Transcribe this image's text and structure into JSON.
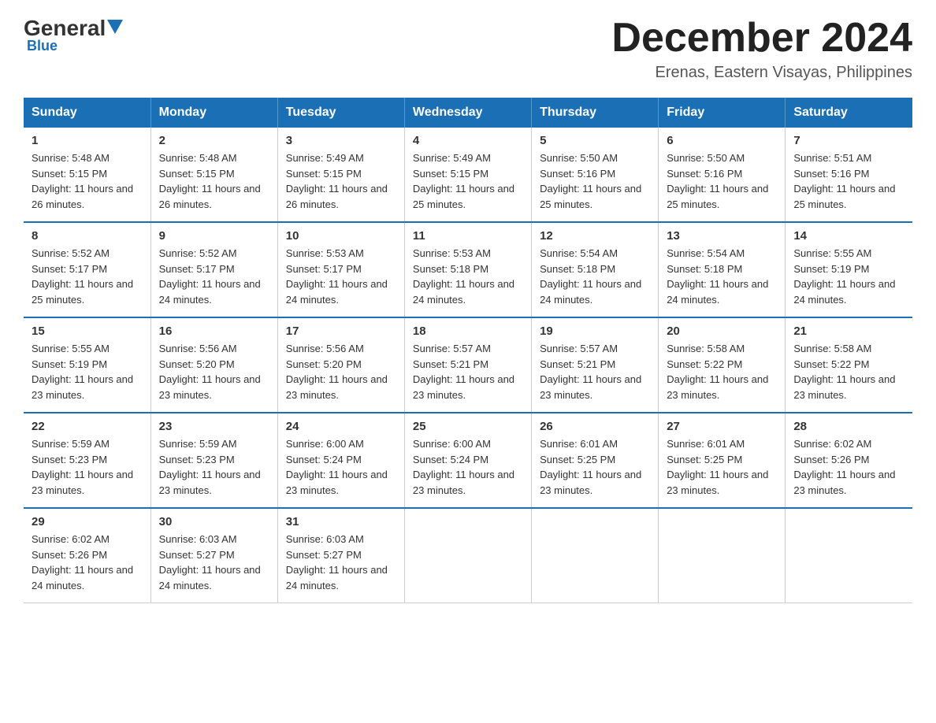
{
  "header": {
    "logo_general": "General",
    "logo_blue": "Blue",
    "month_title": "December 2024",
    "location": "Erenas, Eastern Visayas, Philippines"
  },
  "weekdays": [
    "Sunday",
    "Monday",
    "Tuesday",
    "Wednesday",
    "Thursday",
    "Friday",
    "Saturday"
  ],
  "weeks": [
    [
      {
        "day": "1",
        "sunrise": "5:48 AM",
        "sunset": "5:15 PM",
        "daylight": "11 hours and 26 minutes."
      },
      {
        "day": "2",
        "sunrise": "5:48 AM",
        "sunset": "5:15 PM",
        "daylight": "11 hours and 26 minutes."
      },
      {
        "day": "3",
        "sunrise": "5:49 AM",
        "sunset": "5:15 PM",
        "daylight": "11 hours and 26 minutes."
      },
      {
        "day": "4",
        "sunrise": "5:49 AM",
        "sunset": "5:15 PM",
        "daylight": "11 hours and 25 minutes."
      },
      {
        "day": "5",
        "sunrise": "5:50 AM",
        "sunset": "5:16 PM",
        "daylight": "11 hours and 25 minutes."
      },
      {
        "day": "6",
        "sunrise": "5:50 AM",
        "sunset": "5:16 PM",
        "daylight": "11 hours and 25 minutes."
      },
      {
        "day": "7",
        "sunrise": "5:51 AM",
        "sunset": "5:16 PM",
        "daylight": "11 hours and 25 minutes."
      }
    ],
    [
      {
        "day": "8",
        "sunrise": "5:52 AM",
        "sunset": "5:17 PM",
        "daylight": "11 hours and 25 minutes."
      },
      {
        "day": "9",
        "sunrise": "5:52 AM",
        "sunset": "5:17 PM",
        "daylight": "11 hours and 24 minutes."
      },
      {
        "day": "10",
        "sunrise": "5:53 AM",
        "sunset": "5:17 PM",
        "daylight": "11 hours and 24 minutes."
      },
      {
        "day": "11",
        "sunrise": "5:53 AM",
        "sunset": "5:18 PM",
        "daylight": "11 hours and 24 minutes."
      },
      {
        "day": "12",
        "sunrise": "5:54 AM",
        "sunset": "5:18 PM",
        "daylight": "11 hours and 24 minutes."
      },
      {
        "day": "13",
        "sunrise": "5:54 AM",
        "sunset": "5:18 PM",
        "daylight": "11 hours and 24 minutes."
      },
      {
        "day": "14",
        "sunrise": "5:55 AM",
        "sunset": "5:19 PM",
        "daylight": "11 hours and 24 minutes."
      }
    ],
    [
      {
        "day": "15",
        "sunrise": "5:55 AM",
        "sunset": "5:19 PM",
        "daylight": "11 hours and 23 minutes."
      },
      {
        "day": "16",
        "sunrise": "5:56 AM",
        "sunset": "5:20 PM",
        "daylight": "11 hours and 23 minutes."
      },
      {
        "day": "17",
        "sunrise": "5:56 AM",
        "sunset": "5:20 PM",
        "daylight": "11 hours and 23 minutes."
      },
      {
        "day": "18",
        "sunrise": "5:57 AM",
        "sunset": "5:21 PM",
        "daylight": "11 hours and 23 minutes."
      },
      {
        "day": "19",
        "sunrise": "5:57 AM",
        "sunset": "5:21 PM",
        "daylight": "11 hours and 23 minutes."
      },
      {
        "day": "20",
        "sunrise": "5:58 AM",
        "sunset": "5:22 PM",
        "daylight": "11 hours and 23 minutes."
      },
      {
        "day": "21",
        "sunrise": "5:58 AM",
        "sunset": "5:22 PM",
        "daylight": "11 hours and 23 minutes."
      }
    ],
    [
      {
        "day": "22",
        "sunrise": "5:59 AM",
        "sunset": "5:23 PM",
        "daylight": "11 hours and 23 minutes."
      },
      {
        "day": "23",
        "sunrise": "5:59 AM",
        "sunset": "5:23 PM",
        "daylight": "11 hours and 23 minutes."
      },
      {
        "day": "24",
        "sunrise": "6:00 AM",
        "sunset": "5:24 PM",
        "daylight": "11 hours and 23 minutes."
      },
      {
        "day": "25",
        "sunrise": "6:00 AM",
        "sunset": "5:24 PM",
        "daylight": "11 hours and 23 minutes."
      },
      {
        "day": "26",
        "sunrise": "6:01 AM",
        "sunset": "5:25 PM",
        "daylight": "11 hours and 23 minutes."
      },
      {
        "day": "27",
        "sunrise": "6:01 AM",
        "sunset": "5:25 PM",
        "daylight": "11 hours and 23 minutes."
      },
      {
        "day": "28",
        "sunrise": "6:02 AM",
        "sunset": "5:26 PM",
        "daylight": "11 hours and 23 minutes."
      }
    ],
    [
      {
        "day": "29",
        "sunrise": "6:02 AM",
        "sunset": "5:26 PM",
        "daylight": "11 hours and 24 minutes."
      },
      {
        "day": "30",
        "sunrise": "6:03 AM",
        "sunset": "5:27 PM",
        "daylight": "11 hours and 24 minutes."
      },
      {
        "day": "31",
        "sunrise": "6:03 AM",
        "sunset": "5:27 PM",
        "daylight": "11 hours and 24 minutes."
      },
      null,
      null,
      null,
      null
    ]
  ],
  "labels": {
    "sunrise": "Sunrise:",
    "sunset": "Sunset:",
    "daylight": "Daylight:"
  }
}
